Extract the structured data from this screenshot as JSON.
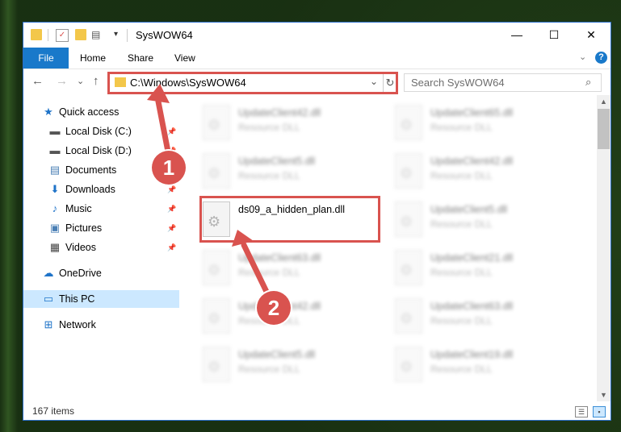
{
  "window": {
    "title": "SysWOW64",
    "controls": {
      "minimize": "—",
      "maximize": "☐",
      "close": "✕"
    }
  },
  "ribbon": {
    "file": "File",
    "tabs": [
      "Home",
      "Share",
      "View"
    ],
    "help": "?"
  },
  "nav": {
    "back": "←",
    "forward": "→",
    "recent": "⌄",
    "up": "↑",
    "address": "C:\\Windows\\SysWOW64",
    "refresh": "↻",
    "search_placeholder": "Search SysWOW64"
  },
  "sidebar": {
    "items": [
      {
        "label": "Quick access",
        "icon": "star-icon",
        "glyph": "★",
        "color": "#1e73c8",
        "pinned": false
      },
      {
        "label": "Local Disk (C:)",
        "icon": "drive-icon",
        "glyph": "▬",
        "color": "#555",
        "pinned": true
      },
      {
        "label": "Local Disk (D:)",
        "icon": "drive-icon",
        "glyph": "▬",
        "color": "#555",
        "pinned": true
      },
      {
        "label": "Documents",
        "icon": "documents-icon",
        "glyph": "▤",
        "color": "#4a7fb5",
        "pinned": true
      },
      {
        "label": "Downloads",
        "icon": "download-icon",
        "glyph": "⬇",
        "color": "#1e73c8",
        "pinned": true
      },
      {
        "label": "Music",
        "icon": "music-icon",
        "glyph": "♪",
        "color": "#1e73c8",
        "pinned": true
      },
      {
        "label": "Pictures",
        "icon": "pictures-icon",
        "glyph": "▣",
        "color": "#4a7fb5",
        "pinned": true
      },
      {
        "label": "Videos",
        "icon": "videos-icon",
        "glyph": "▦",
        "color": "#444",
        "pinned": true
      },
      {
        "label": "OneDrive",
        "icon": "cloud-icon",
        "glyph": "☁",
        "color": "#1e73c8",
        "pinned": false
      },
      {
        "label": "This PC",
        "icon": "computer-icon",
        "glyph": "▭",
        "color": "#1e73c8",
        "pinned": false,
        "selected": true
      },
      {
        "label": "Network",
        "icon": "network-icon",
        "glyph": "⊞",
        "color": "#1e73c8",
        "pinned": false
      }
    ]
  },
  "files": {
    "left_column": [
      {
        "name": "UpdateClient42.dll",
        "type": "Resource DLL"
      },
      {
        "name": "UpdateClient5.dll",
        "type": "Resource DLL"
      },
      {
        "name": "ds09_a_hidden_plan.dll",
        "type": ""
      },
      {
        "name": "UpdateClient63.dll",
        "type": "Resource DLL"
      },
      {
        "name": "UpdateClient42.dll",
        "type": "Resource DLL"
      },
      {
        "name": "UpdateClient5.dll",
        "type": "Resource DLL"
      }
    ],
    "right_column": [
      {
        "name": "UpdateClient65.dll",
        "type": "Resource DLL"
      },
      {
        "name": "UpdateClient42.dll",
        "type": "Resource DLL"
      },
      {
        "name": "UpdateClient5.dll",
        "type": "Resource DLL"
      },
      {
        "name": "UpdateClient21.dll",
        "type": "Resource DLL"
      },
      {
        "name": "UpdateClient63.dll",
        "type": "Resource DLL"
      },
      {
        "name": "UpdateClient19.dll",
        "type": "Resource DLL"
      }
    ]
  },
  "status": {
    "count": "167 items"
  },
  "callouts": {
    "one": "1",
    "two": "2"
  },
  "colors": {
    "accent": "#1979ca",
    "highlight": "#d9534f",
    "selected": "#cce8ff"
  }
}
